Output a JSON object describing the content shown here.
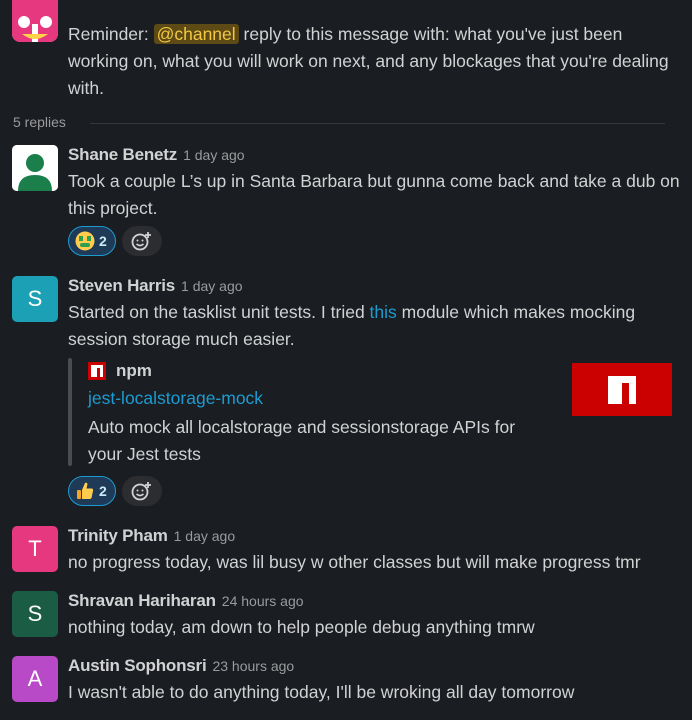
{
  "root_message": {
    "text_before": "Reminder: ",
    "mention": "@channel",
    "text_after": " reply to this message with: what you've just been working on, what you will work on next, and any blockages that you're dealing with."
  },
  "thread": {
    "replies_label": "5 replies"
  },
  "messages": [
    {
      "author": "Shane Benetz",
      "time": "1 day ago",
      "text": "Took a couple L’s up in Santa Barbara but gunna come back and take a dub on this project.",
      "reaction": {
        "emoji": "money-mouth-face",
        "count": "2"
      }
    },
    {
      "author": "Steven Harris",
      "initial": "S",
      "time": "1 day ago",
      "text_before": "Started on the tasklist unit tests. I tried ",
      "link_text": "this",
      "text_after": " module which makes mocking session storage much easier.",
      "unfurl": {
        "site": "npm",
        "title": "jest-localstorage-mock",
        "description": "Auto mock all localstorage and sessionstorage APIs for your Jest tests"
      },
      "reaction": {
        "emoji": "thumbs-up",
        "count": "2"
      }
    },
    {
      "author": "Trinity Pham",
      "initial": "T",
      "time": "1 day ago",
      "text": "no progress today, was lil busy w other classes but will make progress tmr"
    },
    {
      "author": "Shravan Hariharan",
      "initial": "S",
      "time": "24 hours ago",
      "text": "nothing today, am down to help people debug anything tmrw"
    },
    {
      "author": "Austin Sophonsri",
      "initial": "A",
      "time": "23 hours ago",
      "text": "I wasn't able to do anything today, I'll be wroking all day tomorrow"
    }
  ],
  "colors": {
    "background": "#1a1d21",
    "link": "#1d9bd1",
    "mention_bg": "#5e4a14",
    "mention_text": "#f2c744",
    "avatar_steven": "#1ba0b5",
    "avatar_trinity": "#e5387f",
    "avatar_shravan": "#1b5c44",
    "avatar_austin": "#b84ac8",
    "npm_red": "#cb0000"
  }
}
